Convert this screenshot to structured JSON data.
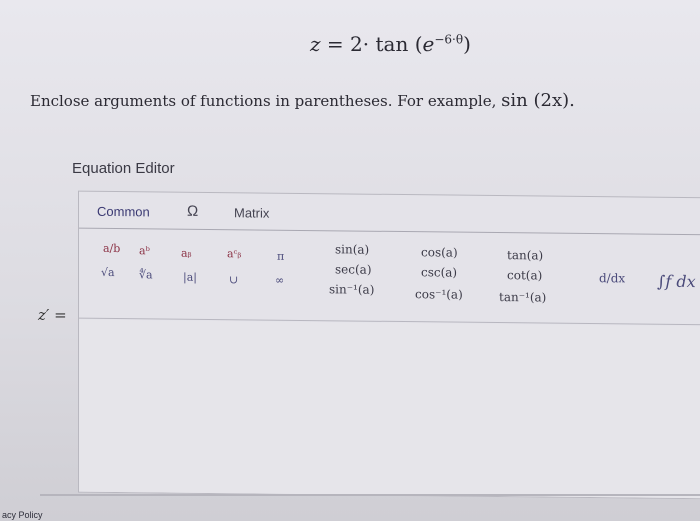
{
  "formula": {
    "lhs": "z",
    "eq": "=",
    "coef": "2",
    "dot": "·",
    "func": "tan",
    "open": "(",
    "base": "e",
    "exponent": "−6·θ",
    "close": ")"
  },
  "instruction": {
    "text": "Enclose arguments of functions in parentheses. For example,",
    "example": "sin (2x)."
  },
  "editor": {
    "title": "Equation Editor",
    "tabs": [
      "Common",
      "Ω",
      "Matrix"
    ],
    "palette": {
      "fraction": "a/b",
      "power": "aᵇ",
      "subscript": "aᵦ",
      "subsup": "aᶜᵦ",
      "pi": "π",
      "sqrt": "√a",
      "nroot": "∜a",
      "abs": "|a|",
      "union": "∪",
      "infinity": "∞",
      "trig": [
        [
          "sin(a)",
          "cos(a)",
          "tan(a)"
        ],
        [
          "sec(a)",
          "csc(a)",
          "cot(a)"
        ],
        [
          "sin⁻¹(a)",
          "cos⁻¹(a)",
          "tan⁻¹(a)"
        ]
      ],
      "derivative": "d/dx",
      "integral": "∫f dx"
    },
    "answer_label": "z′ ="
  },
  "footer": "acy Policy"
}
